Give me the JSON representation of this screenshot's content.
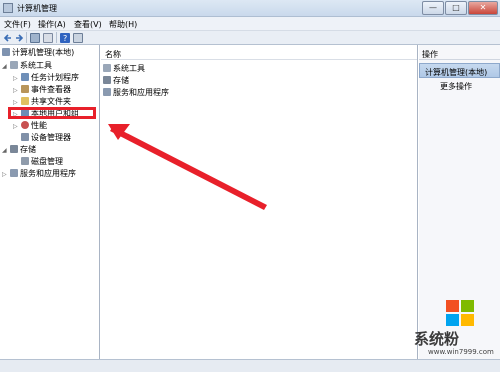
{
  "window": {
    "title": "计算机管理",
    "controls": {
      "minimize": "—",
      "maximize": "□",
      "close": "✕"
    }
  },
  "menu": {
    "items": [
      {
        "label": "文件(F)"
      },
      {
        "label": "操作(A)"
      },
      {
        "label": "查看(V)"
      },
      {
        "label": "帮助(H)"
      }
    ]
  },
  "toolbar": {
    "icons": [
      "back-icon",
      "forward-icon",
      "folder-up-icon",
      "properties-icon",
      "help-icon",
      "console-icon"
    ]
  },
  "tree": {
    "root": "计算机管理(本地)",
    "nodes": [
      {
        "label": "系统工具",
        "level": 1
      },
      {
        "label": "任务计划程序",
        "level": 2
      },
      {
        "label": "事件查看器",
        "level": 2
      },
      {
        "label": "共享文件夹",
        "level": 2
      },
      {
        "label": "本地用户和组",
        "level": 2
      },
      {
        "label": "性能",
        "level": 2
      },
      {
        "label": "设备管理器",
        "level": 2
      },
      {
        "label": "存储",
        "level": 1
      },
      {
        "label": "磁盘管理",
        "level": 2
      },
      {
        "label": "服务和应用程序",
        "level": 1
      }
    ]
  },
  "center": {
    "column_header": "名称",
    "items": [
      {
        "label": "系统工具"
      },
      {
        "label": "存储"
      },
      {
        "label": "服务和应用程序"
      }
    ]
  },
  "actions": {
    "header": "操作",
    "group": "计算机管理(本地)",
    "more": "更多操作"
  },
  "watermark": {
    "brand": "系统粉",
    "url": "www.win7999.com"
  },
  "colors": {
    "highlight": "#e8202a",
    "arrow": "#e8202a",
    "selection": "#c6d9ef"
  }
}
